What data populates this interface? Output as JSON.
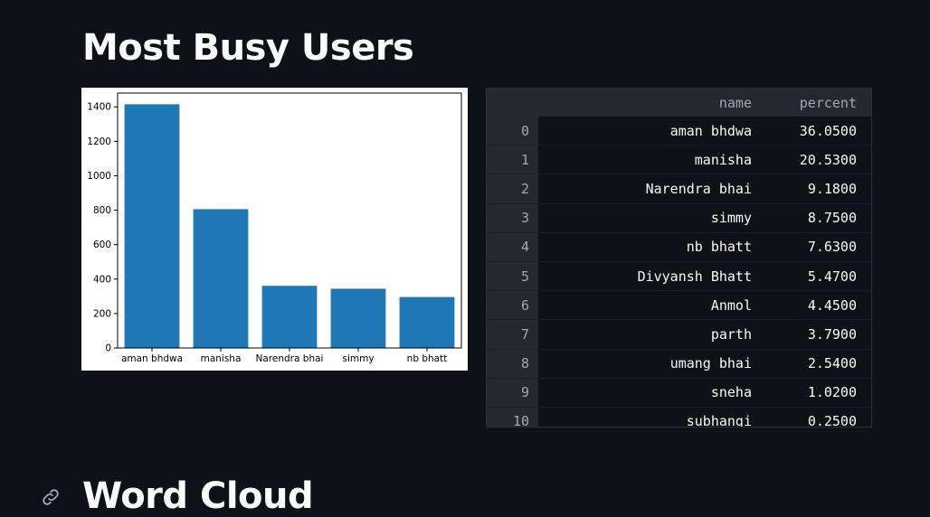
{
  "sections": {
    "busy_title": "Most Busy Users",
    "cloud_title": "Word Cloud"
  },
  "icons": {
    "anchor": "link-icon"
  },
  "chart_data": {
    "type": "bar",
    "categories": [
      "aman bhdwa",
      "manisha",
      "Narendra bhai",
      "simmy",
      "nb bhatt"
    ],
    "values": [
      1415,
      806,
      361,
      344,
      296
    ],
    "ylim": [
      0,
      1480
    ],
    "yticks": [
      0,
      200,
      400,
      600,
      800,
      1000,
      1200,
      1400
    ],
    "bar_color": "#1f77b4",
    "grid": false
  },
  "table": {
    "columns": [
      "",
      "name",
      "percent"
    ],
    "rows": [
      {
        "index": "0",
        "name": "aman bhdwa",
        "percent": "36.0500"
      },
      {
        "index": "1",
        "name": "manisha",
        "percent": "20.5300"
      },
      {
        "index": "2",
        "name": "Narendra bhai",
        "percent": "9.1800"
      },
      {
        "index": "3",
        "name": "simmy",
        "percent": "8.7500"
      },
      {
        "index": "4",
        "name": "nb bhatt",
        "percent": "7.6300"
      },
      {
        "index": "5",
        "name": "Divyansh Bhatt",
        "percent": "5.4700"
      },
      {
        "index": "6",
        "name": "Anmol",
        "percent": "4.4500"
      },
      {
        "index": "7",
        "name": "parth",
        "percent": "3.7900"
      },
      {
        "index": "8",
        "name": "umang bhai",
        "percent": "2.5400"
      },
      {
        "index": "9",
        "name": "sneha",
        "percent": "1.0200"
      },
      {
        "index": "10",
        "name": "subhangi",
        "percent": "0.2500"
      }
    ]
  }
}
